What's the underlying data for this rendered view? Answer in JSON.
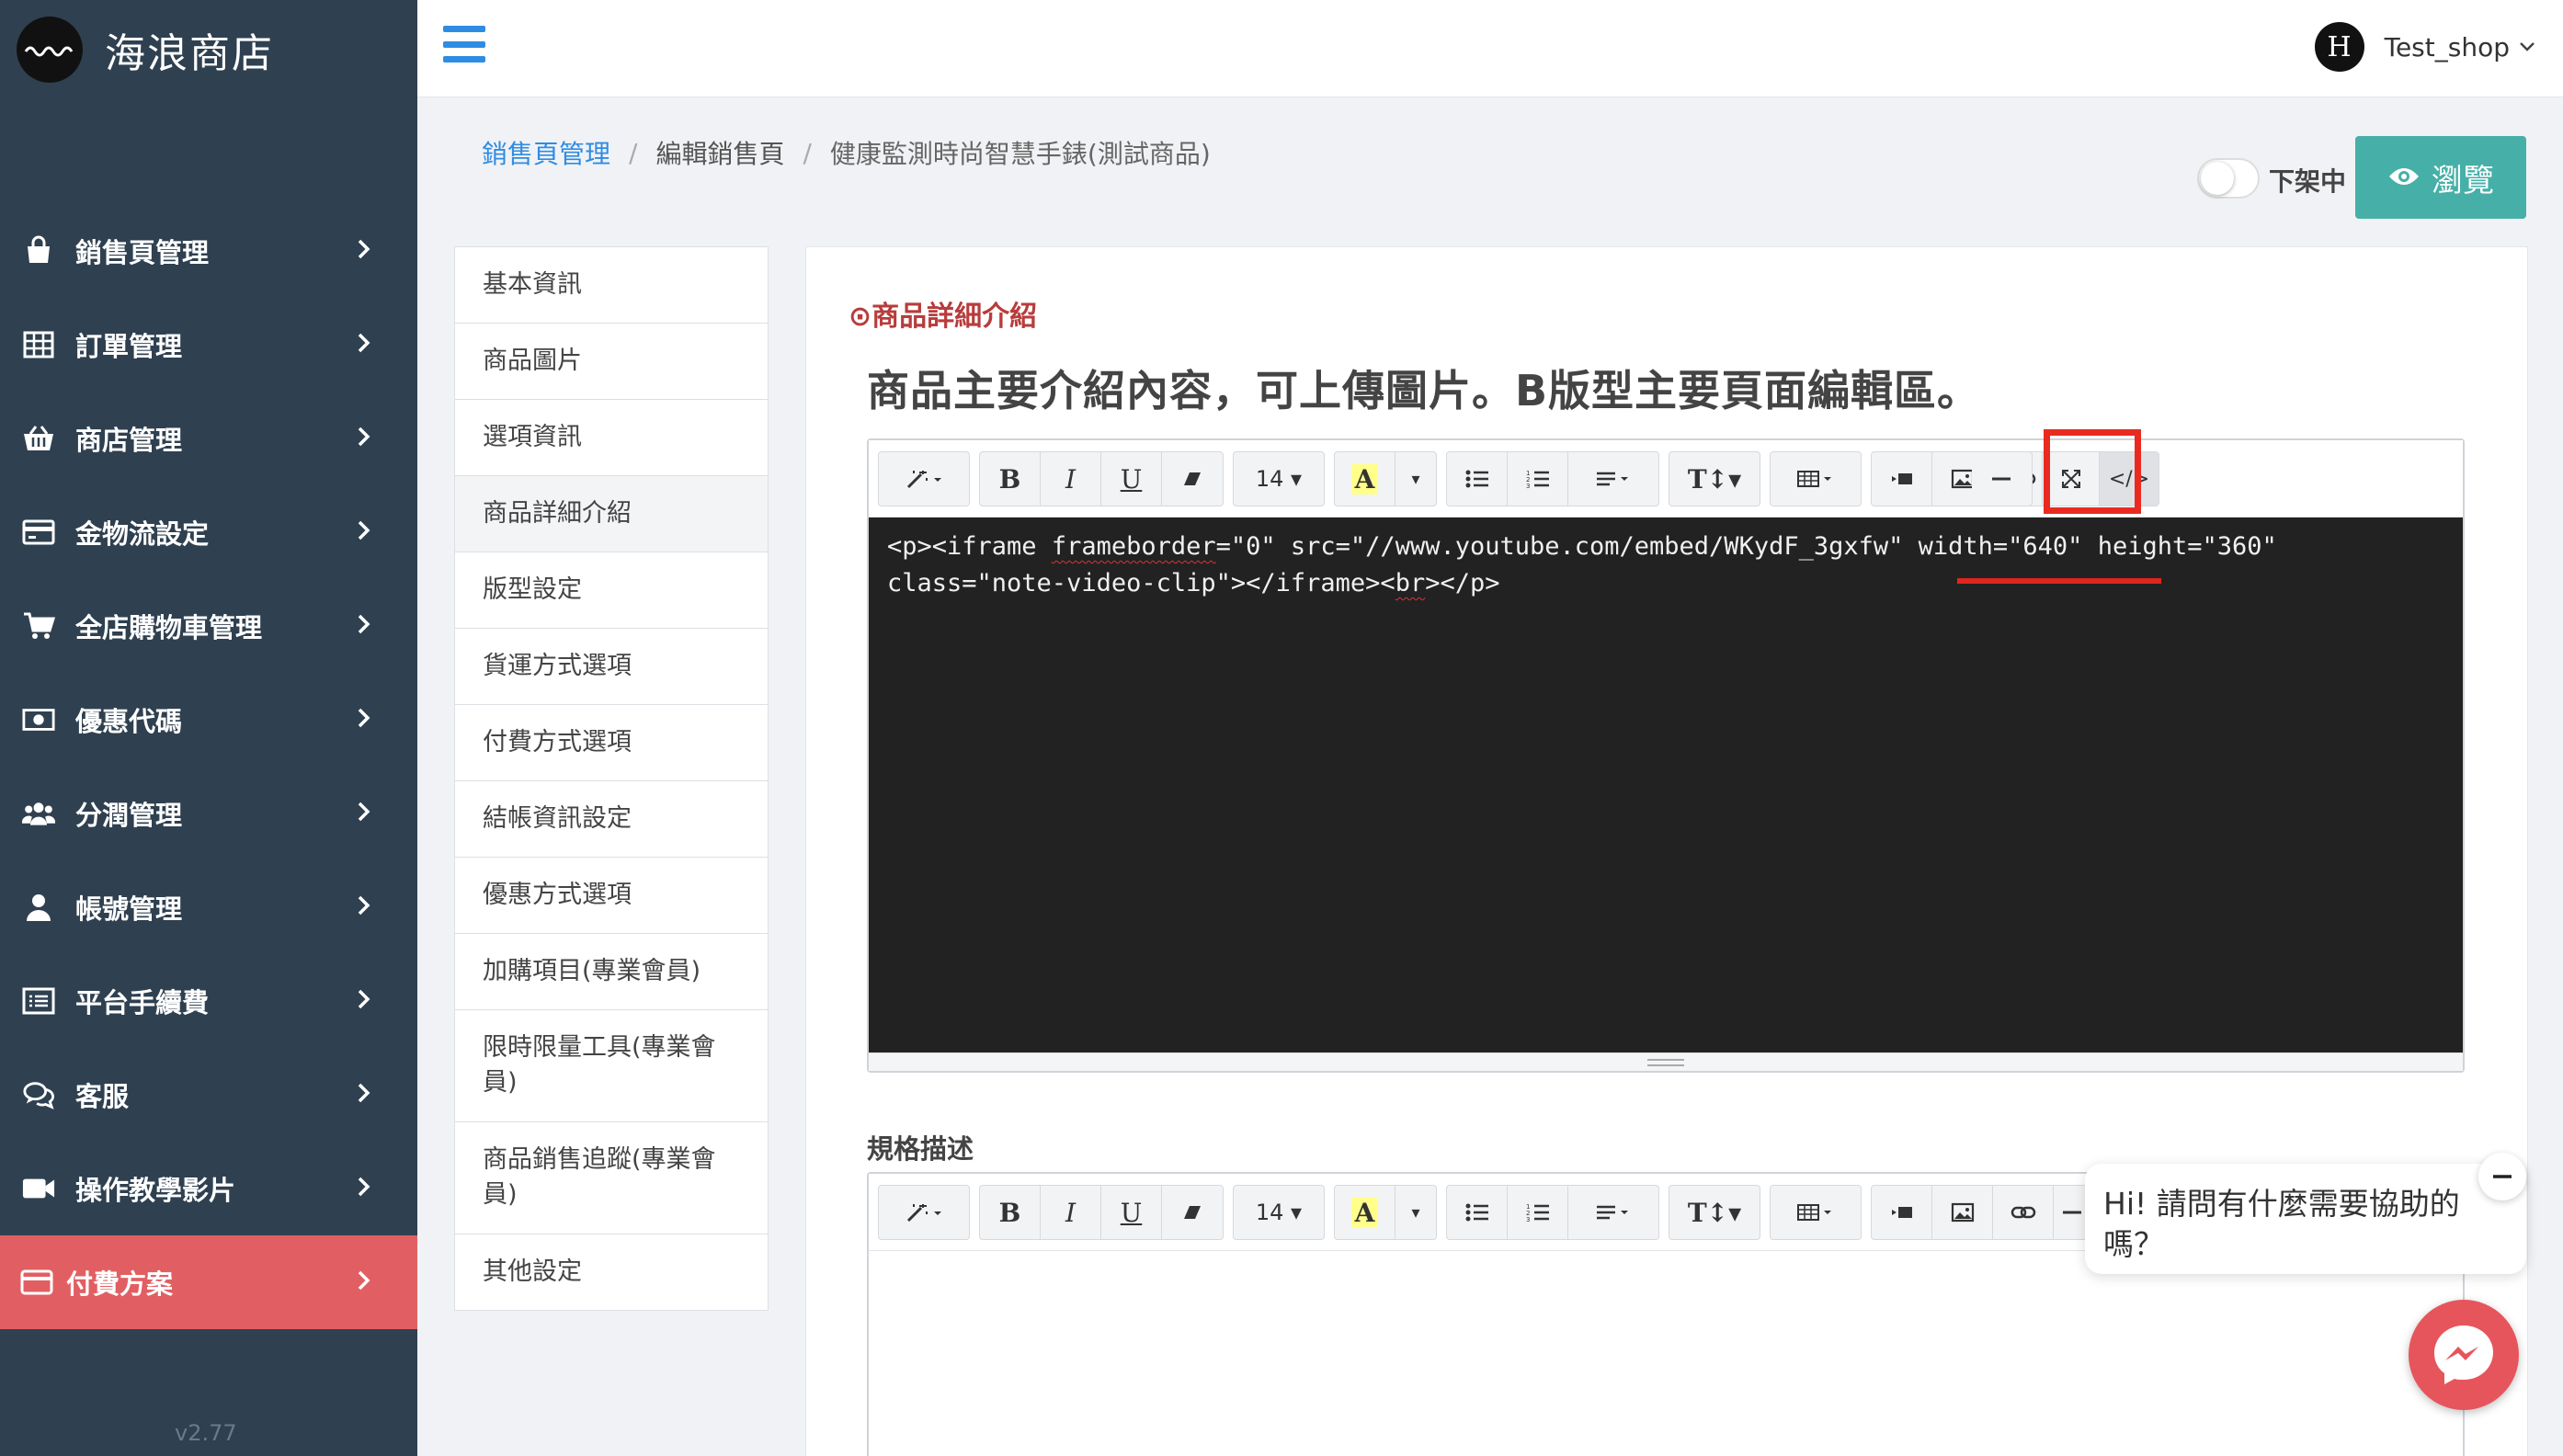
{
  "brand": {
    "name": "海浪商店",
    "logo_icon": "wave-logo-icon"
  },
  "sidebar": {
    "items": [
      {
        "label": "銷售頁管理",
        "icon": "shopping-bag-icon"
      },
      {
        "label": "訂單管理",
        "icon": "table-grid-icon"
      },
      {
        "label": "商店管理",
        "icon": "basket-icon"
      },
      {
        "label": "金物流設定",
        "icon": "credit-card-icon"
      },
      {
        "label": "全店購物車管理",
        "icon": "cart-icon"
      },
      {
        "label": "優惠代碼",
        "icon": "money-icon"
      },
      {
        "label": "分潤管理",
        "icon": "users-icon"
      },
      {
        "label": "帳號管理",
        "icon": "user-icon"
      },
      {
        "label": "平台手續費",
        "icon": "list-icon"
      },
      {
        "label": "客服",
        "icon": "chat-icon"
      },
      {
        "label": "操作教學影片",
        "icon": "video-camera-icon"
      },
      {
        "label": "付費方案",
        "icon": "card-icon"
      }
    ],
    "active_index": 11,
    "version": "v2.77"
  },
  "topbar": {
    "user_name": "Test_shop",
    "user_initial": "H"
  },
  "breadcrumb": {
    "items": [
      "銷售頁管理",
      "編輯銷售頁",
      "健康監測時尚智慧手錶(測試商品)"
    ]
  },
  "status": {
    "toggle_label": "下架中",
    "toggle_on": false
  },
  "preview_button": {
    "label": "瀏覽"
  },
  "tabs": [
    "基本資訊",
    "商品圖片",
    "選項資訊",
    "商品詳細介紹",
    "版型設定",
    "貨運方式選項",
    "付費方式選項",
    "結帳資訊設定",
    "優惠方式選項",
    "加購項目(專業會員)",
    "限時限量工具(專業會員)",
    "商品銷售追蹤(專業會員)",
    "其他設定"
  ],
  "active_tab_index": 3,
  "editor": {
    "section_title": "⊙商品詳細介紹",
    "heading": "商品主要介紹內容，可上傳圖片。B版型主要頁面編輯區。",
    "font_size": "14",
    "code_line1_a": "<p><iframe ",
    "code_line1_b": "frameborder",
    "code_line1_c": "=\"0\" src=\"//www.youtube.com/embed/WKydF_3gxfw\" width=\"640\" height=\"360\"",
    "code_line2_a": "class=\"note-video-clip\"></iframe><",
    "code_line2_b": "br",
    "code_line2_c": "></p>"
  },
  "spec": {
    "label": "規格描述",
    "font_size": "14"
  },
  "chat": {
    "message": "Hi! 請問有什麼需要協助的嗎？"
  },
  "colors": {
    "sidebar_bg": "#2f4050",
    "active": "#e15f62",
    "link": "#2f8ce3",
    "preview": "#46b0a8",
    "highlight": "#ea2a20"
  }
}
